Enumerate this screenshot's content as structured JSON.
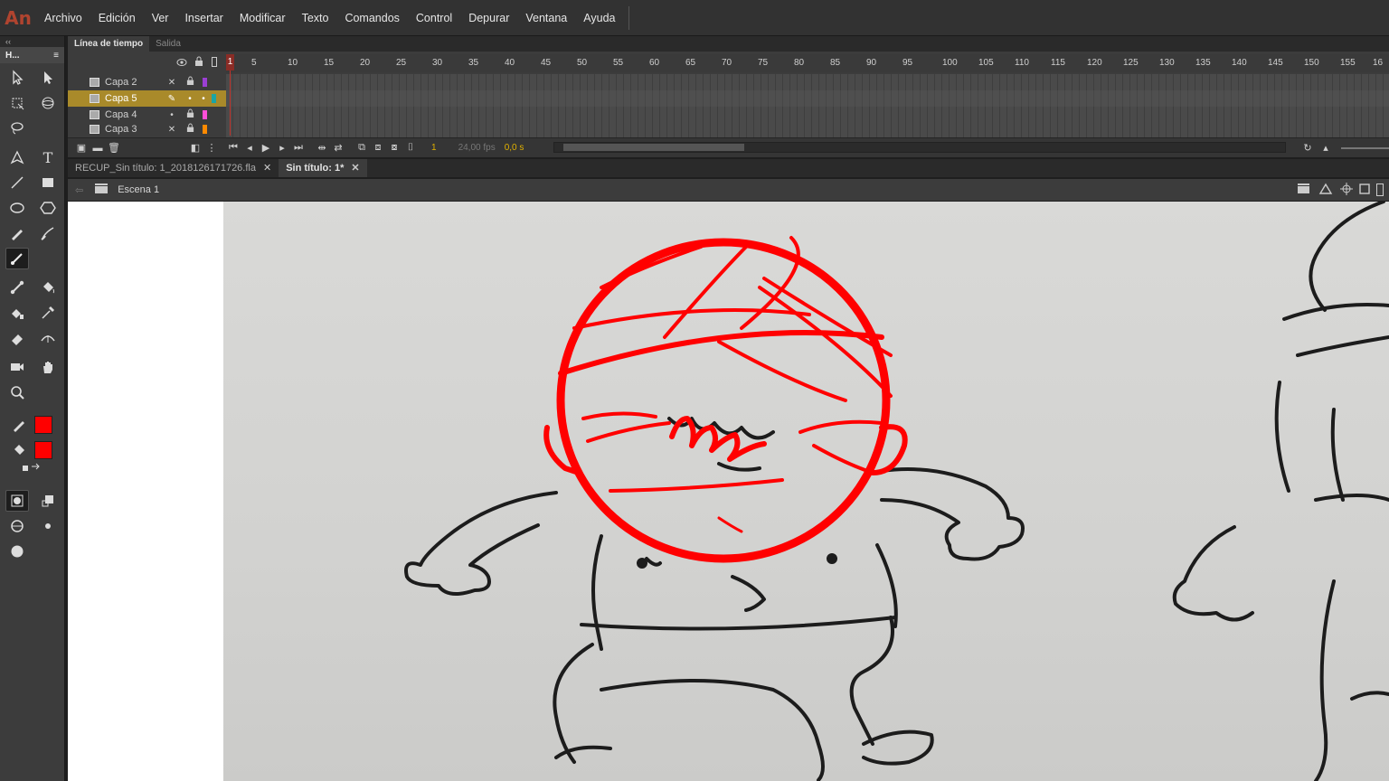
{
  "app": {
    "logo": "An"
  },
  "menu": [
    "Archivo",
    "Edición",
    "Ver",
    "Insertar",
    "Modificar",
    "Texto",
    "Comandos",
    "Control",
    "Depurar",
    "Ventana",
    "Ayuda"
  ],
  "tools_panel": {
    "collapse": "‹‹",
    "title": "H...",
    "menu_icon": "≡"
  },
  "timeline": {
    "tabs": [
      "Línea de tiempo",
      "Salida"
    ],
    "playhead_label": "1",
    "frame_numbers": [
      "5",
      "10",
      "15",
      "20",
      "25",
      "30",
      "35",
      "40",
      "45",
      "50",
      "55",
      "60",
      "65",
      "70",
      "75",
      "80",
      "85",
      "90",
      "95",
      "100",
      "105",
      "110",
      "115",
      "120",
      "125",
      "130",
      "135",
      "140",
      "145",
      "150",
      "155",
      "16"
    ],
    "layers": [
      {
        "name": "Capa 2",
        "color": "#9b3fd4",
        "selected": false
      },
      {
        "name": "Capa 5",
        "color": "#1aa5a5",
        "selected": true
      },
      {
        "name": "Capa 4",
        "color": "#ff4fd8",
        "selected": false
      },
      {
        "name": "Capa 3",
        "color": "#ff8a00",
        "selected": false
      }
    ],
    "footer": {
      "current_frame": "1",
      "fps": "24,00 fps",
      "time": "0,0 s"
    }
  },
  "documents": {
    "tabs": [
      {
        "label": "RECUP_Sin título: 1_2018126171726.fla",
        "active": false
      },
      {
        "label": "Sin título: 1*",
        "active": true
      }
    ],
    "close_glyph": "✕"
  },
  "scene": {
    "name": "Escena 1"
  },
  "colors": {
    "stroke": "#ff0000",
    "fill": "#ff0000",
    "accent": "#a98a2a"
  }
}
